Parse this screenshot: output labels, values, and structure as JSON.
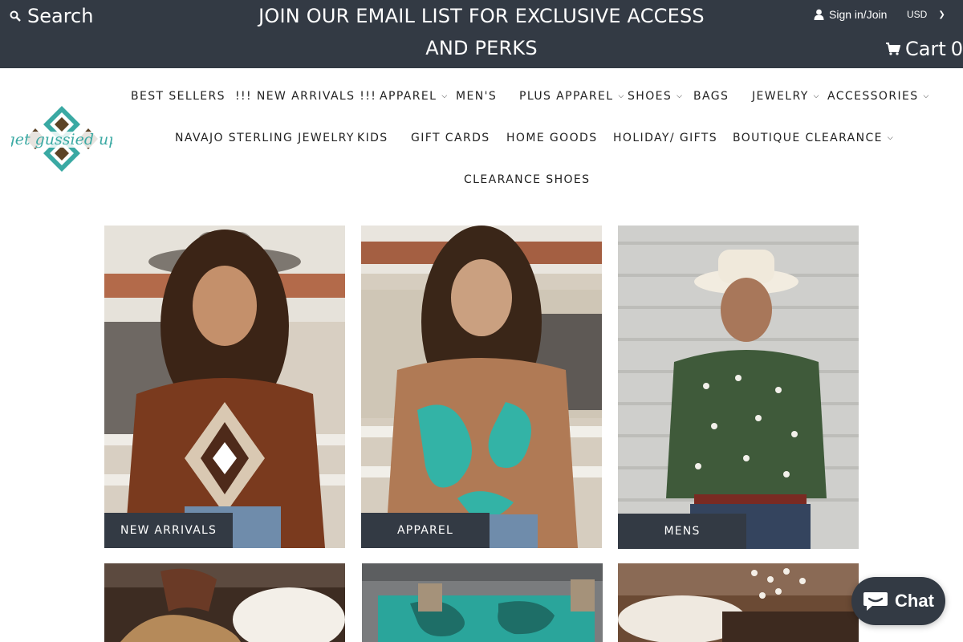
{
  "header": {
    "search_label": "Search",
    "promo_text": "JOIN OUR EMAIL LIST FOR EXCLUSIVE ACCESS AND PERKS",
    "signin_label": "Sign in/Join",
    "currency": "USD",
    "cart_label": "Cart",
    "cart_count": "0"
  },
  "logo": {
    "text": "get gussied up"
  },
  "nav": {
    "items": [
      {
        "label": "BEST SELLERS"
      },
      {
        "label": "!!! NEW ARRIVALS !!!"
      },
      {
        "label": "APPAREL"
      },
      {
        "label": "MEN'S"
      },
      {
        "label": "PLUS APPAREL"
      },
      {
        "label": "SHOES"
      },
      {
        "label": "BAGS"
      },
      {
        "label": "JEWELRY"
      },
      {
        "label": "ACCESSORIES"
      },
      {
        "label": "NAVAJO STERLING JEWELRY"
      },
      {
        "label": "KIDS"
      },
      {
        "label": "GIFT CARDS"
      },
      {
        "label": "HOME GOODS"
      },
      {
        "label": "HOLIDAY/ GIFTS"
      },
      {
        "label": "BOUTIQUE CLEARANCE"
      },
      {
        "label": "CLEARANCE SHOES"
      }
    ]
  },
  "tiles": [
    {
      "label": "NEW ARRIVALS"
    },
    {
      "label": "APPAREL"
    },
    {
      "label": "MENS"
    }
  ],
  "chat": {
    "label": "Chat"
  },
  "colors": {
    "dark": "#333a44",
    "teal": "#3aa9a3",
    "brown": "#5c4326"
  }
}
